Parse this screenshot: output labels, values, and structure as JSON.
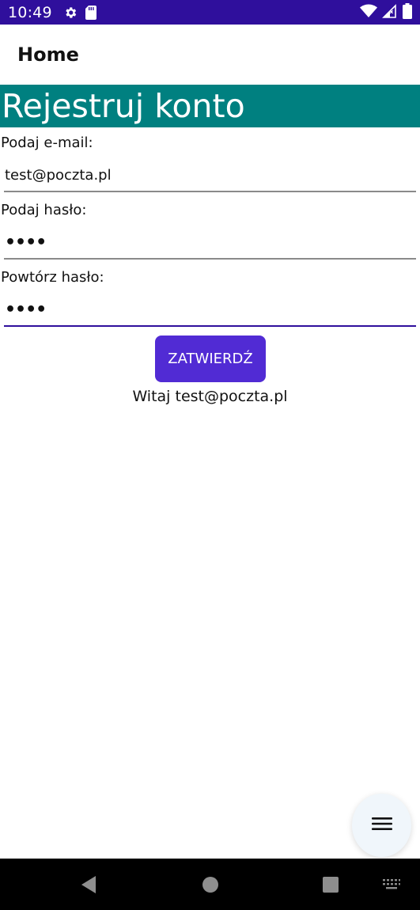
{
  "status_bar": {
    "time": "10:49",
    "icons": [
      "gear-icon",
      "sd-card-icon",
      "wifi-icon",
      "signal-icon",
      "battery-icon"
    ],
    "background": "#2f0f9c"
  },
  "app_bar": {
    "title": "Home"
  },
  "header": {
    "title": "Rejestruj konto",
    "background": "#008080"
  },
  "form": {
    "email_label": "Podaj e-mail:",
    "email_value": "test@poczta.pl",
    "password_label": "Podaj hasło:",
    "password_value": "••••",
    "repeat_label": "Powtórz hasło:",
    "repeat_value": "••••",
    "submit_label": "ZATWIERDŹ",
    "accent": "#512bd4"
  },
  "welcome": {
    "text": "Witaj test@poczta.pl"
  },
  "fab": {
    "icon": "hamburger-menu-icon"
  },
  "nav_bar": {
    "icons": [
      "back-icon",
      "home-icon",
      "recents-icon",
      "keyboard-icon"
    ]
  }
}
